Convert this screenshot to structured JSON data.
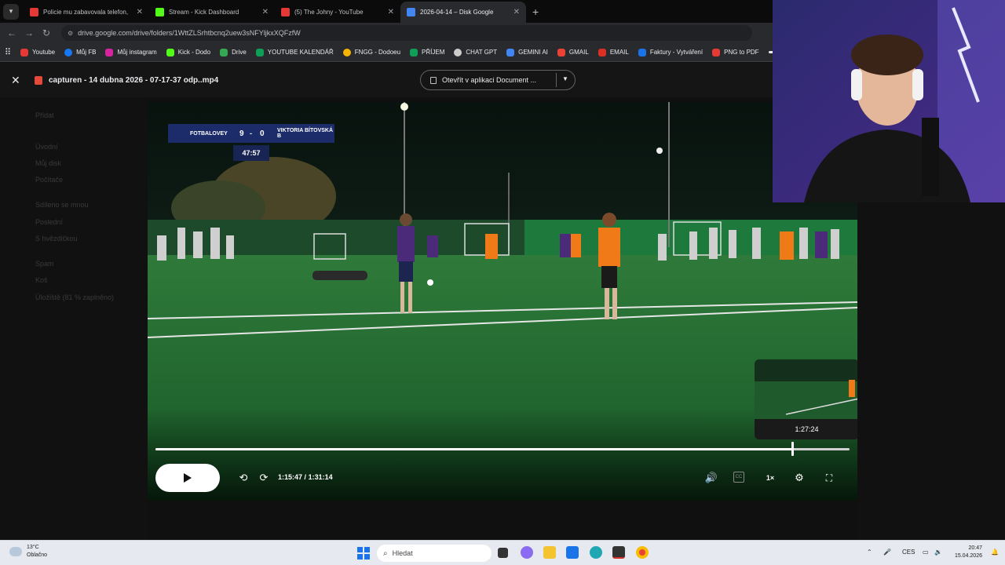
{
  "browser": {
    "tabs": [
      {
        "title": "Policie mu zabavovala telefon,",
        "color": "#e53935",
        "active": false
      },
      {
        "title": "Stream - Kick Dashboard",
        "color": "#53fc18",
        "active": false
      },
      {
        "title": "(5) The Johny - YouTube",
        "color": "#e53935",
        "active": false
      },
      {
        "title": "2026-04-14 – Disk Google",
        "color": "#4285f4",
        "active": true
      }
    ],
    "url": "drive.google.com/drive/folders/1WttZLSrhtbcnq2uew3sNFYljkxXQFzfW",
    "bookmarks": [
      {
        "label": "Youtube",
        "color": "#e53935"
      },
      {
        "label": "Můj FB",
        "color": "#1877f2"
      },
      {
        "label": "Můj instagram",
        "color": "#d6249f"
      },
      {
        "label": "Kick - Dodo",
        "color": "#53fc18"
      },
      {
        "label": "Drive",
        "color": "#34a853"
      },
      {
        "label": "YOUTUBE KALENDÁŘ",
        "color": "#0f9d58"
      },
      {
        "label": "FNGG - Dodoeu",
        "color": "#f4b400"
      },
      {
        "label": "PŘÍJEM",
        "color": "#0f9d58"
      },
      {
        "label": "CHAT GPT",
        "color": "#cccccc"
      },
      {
        "label": "GEMINI AI",
        "color": "#4285f4"
      },
      {
        "label": "GMAIL",
        "color": "#ea4335"
      },
      {
        "label": "EMAIL",
        "color": "#d93025"
      },
      {
        "label": "Faktury - Vytváření",
        "color": "#1a73e8"
      },
      {
        "label": "PNG to PDF",
        "color": "#e53935"
      }
    ]
  },
  "drive": {
    "filename": "capturen - 14 dubna 2026 - 07-17-37 odp..mp4",
    "open_button": "Otevřít v aplikaci Document ..."
  },
  "sidebar_bg": [
    "Přidat",
    "Úvodní",
    "Můj disk",
    "Počítače",
    "Sdíleno se mnou",
    "Poslední",
    "S hvězdičkou",
    "Spam",
    "Koš",
    "Úložiště (81 % zaplněno)"
  ],
  "video": {
    "scoreboard": {
      "team_home": "FOTBALOVEY",
      "score_home": "9",
      "dash": "-",
      "score_away": "0",
      "team_away": "VIKTORIA BÍTOVSKÁ B"
    },
    "game_clock": "47:57",
    "current_time": "1:15:47",
    "separator": "/",
    "duration": "1:31:14",
    "progress_fraction": 0.9177,
    "hover_preview_time": "1:27:24",
    "speed": "1×"
  },
  "taskbar": {
    "weather_temp": "13°C",
    "weather_desc": "Oblačno",
    "search_placeholder": "Hledat",
    "lang": "CES",
    "time": "20:47",
    "date": "15.04.2026"
  }
}
